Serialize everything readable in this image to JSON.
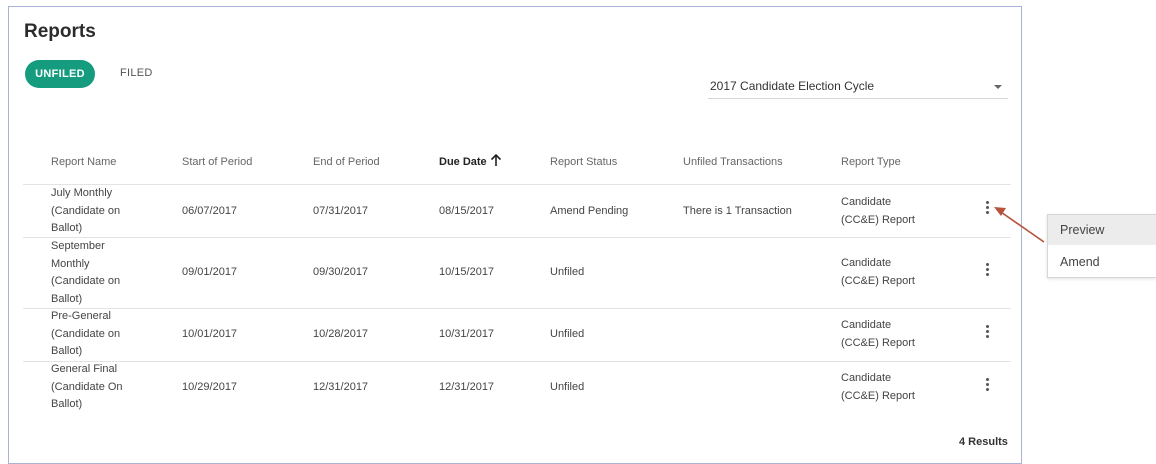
{
  "header": {
    "title": "Reports"
  },
  "tabs": [
    {
      "label": "UNFILED",
      "active": true
    },
    {
      "label": "FILED",
      "active": false
    }
  ],
  "cycle_select": {
    "value": "2017 Candidate Election Cycle"
  },
  "table": {
    "headers": {
      "name": "Report Name",
      "start": "Start of Period",
      "end": "End of Period",
      "due": "Due Date",
      "status": "Report Status",
      "transactions": "Unfiled Transactions",
      "type": "Report Type"
    },
    "sort": {
      "column": "due",
      "direction": "ascending"
    },
    "rows": [
      {
        "name": [
          "July Monthly",
          "(Candidate on",
          "Ballot)"
        ],
        "start": "06/07/2017",
        "end": "07/31/2017",
        "due": "08/15/2017",
        "status": "Amend Pending",
        "transactions": "There is 1 Transaction",
        "type": [
          "Candidate",
          "(CC&E) Report"
        ]
      },
      {
        "name": [
          "September",
          "Monthly",
          "(Candidate on",
          "Ballot)"
        ],
        "start": "09/01/2017",
        "end": "09/30/2017",
        "due": "10/15/2017",
        "status": "Unfiled",
        "transactions": "",
        "type": [
          "Candidate",
          "(CC&E) Report"
        ]
      },
      {
        "name": [
          "Pre-General",
          "(Candidate on",
          "Ballot)"
        ],
        "start": "10/01/2017",
        "end": "10/28/2017",
        "due": "10/31/2017",
        "status": "Unfiled",
        "transactions": "",
        "type": [
          "Candidate",
          "(CC&E) Report"
        ]
      },
      {
        "name": [
          "General Final",
          "(Candidate On",
          "Ballot)"
        ],
        "start": "10/29/2017",
        "end": "12/31/2017",
        "due": "12/31/2017",
        "status": "Unfiled",
        "transactions": "",
        "type": [
          "Candidate",
          "(CC&E) Report"
        ]
      }
    ],
    "results_label": "4 Results"
  },
  "context_menu": {
    "items": [
      {
        "label": "Preview",
        "highlighted": true
      },
      {
        "label": "Amend",
        "highlighted": false
      }
    ]
  },
  "colors": {
    "accent": "#159c7e",
    "panel_border": "#aab2d8",
    "annotation_arrow": "#b5533c"
  },
  "icons": {
    "sort": "arrow-up-icon",
    "row_menu": "more-vert-icon",
    "dropdown": "caret-down-icon"
  }
}
